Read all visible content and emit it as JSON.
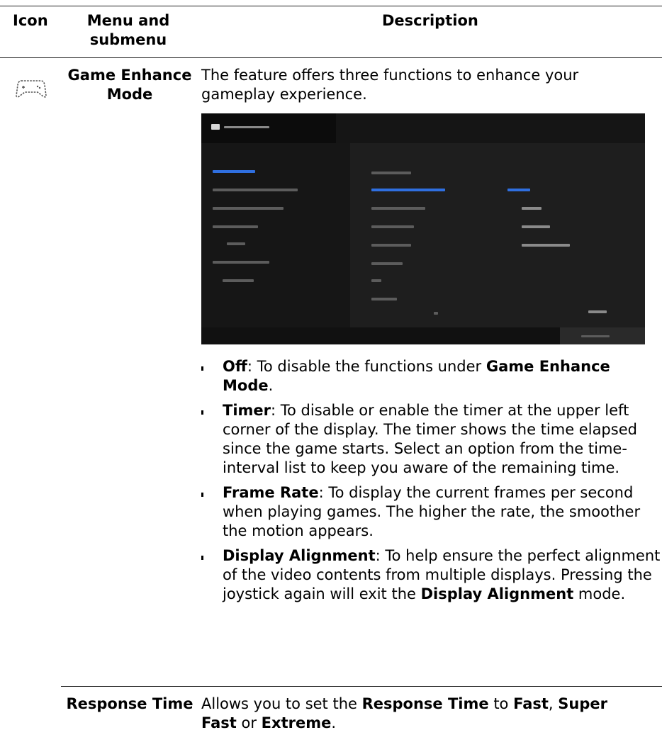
{
  "header": {
    "icon": "Icon",
    "menu": "Menu and submenu",
    "description": "Description"
  },
  "row1": {
    "icon_name": "gamepad-icon",
    "title": "Game Enhance Mode",
    "intro": "The feature offers three functions to enhance your gameplay experience.",
    "bullets": [
      {
        "term": "Off",
        "text_before": ": To disable the functions under ",
        "em": "Game Enhance Mode",
        "text_after": "."
      },
      {
        "term": "Timer",
        "text": ": To disable or enable the timer at the upper left corner of the display. The timer shows the time elapsed since the game starts. Select an option from the time-interval list to keep you aware of the remaining time."
      },
      {
        "term": "Frame Rate",
        "text": ": To display the current frames per second when playing games. The higher the rate, the smoother the motion appears."
      },
      {
        "term": "Display Alignment",
        "text_before": ": To help ensure the perfect alignment of the video contents from multiple displays. Pressing the joystick again will exit the ",
        "em": "Display Alignment",
        "text_after": " mode."
      }
    ]
  },
  "row2": {
    "title": "Response Time",
    "desc_parts": [
      "Allows you to set the ",
      "Response Time",
      " to ",
      "Fast",
      ", ",
      "Super Fast",
      " or ",
      "Extreme",
      "."
    ]
  },
  "colors": {
    "osd_bg": "#151515",
    "osd_accent": "#2f6fe0"
  }
}
